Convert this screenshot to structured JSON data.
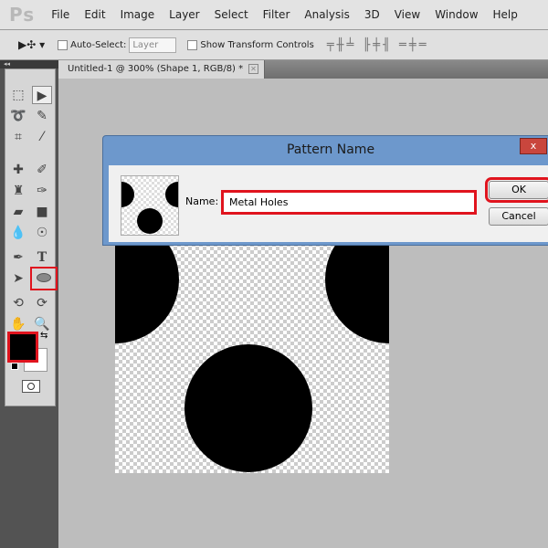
{
  "app": {
    "logo": "Ps"
  },
  "menu": [
    "File",
    "Edit",
    "Image",
    "Layer",
    "Select",
    "Filter",
    "Analysis",
    "3D",
    "View",
    "Window",
    "Help"
  ],
  "options": {
    "auto_select_label": "Auto-Select:",
    "layer_select": "Layer",
    "transform_label": "Show Transform Controls",
    "auto_select_checked": false,
    "transform_checked": false
  },
  "document_tab": {
    "title": "Untitled-1 @ 300% (Shape 1, RGB/8) *"
  },
  "toolbox": {
    "collapse": "◂◂",
    "highlighted_tool": "ellipse-tool",
    "foreground_color": "#000000",
    "background_color": "#ffffff"
  },
  "dialog": {
    "title": "Pattern Name",
    "name_label": "Name:",
    "name_value": "Metal Holes",
    "ok_label": "OK",
    "cancel_label": "Cancel",
    "close": "x"
  },
  "colors": {
    "highlight": "#e0141e",
    "titlebar": "#6d98cc"
  }
}
